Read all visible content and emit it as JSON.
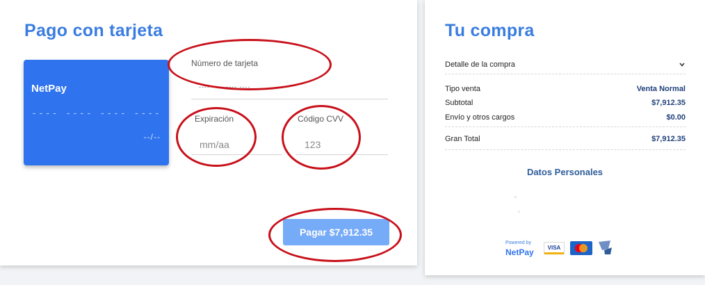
{
  "payment": {
    "title": "Pago con tarjeta",
    "card": {
      "brand": "NetPay",
      "number_mask": "---- ---- ---- ----",
      "expiry_mask": "--/--"
    },
    "fields": {
      "card_number_label": "Número de tarjeta",
      "card_number_placeholder": "---- ---- ---- ----",
      "expiry_label": "Expiración",
      "expiry_placeholder": "mm/aa",
      "cvv_label": "Código CVV",
      "cvv_placeholder": "123"
    },
    "pay_button_label": "Pagar $7,912.35"
  },
  "summary": {
    "title": "Tu compra",
    "detail_header": "Detalle de la compra",
    "rows": [
      {
        "label": "Tipo venta",
        "value": "Venta Normal"
      },
      {
        "label": "Subtotal",
        "value": "$7,912.35"
      },
      {
        "label": "Envío y otros cargos",
        "value": "$0.00"
      }
    ],
    "total": {
      "label": "Gran Total",
      "value": "$7,912.35"
    },
    "personal_data_title": "Datos Personales",
    "footer": {
      "powered_by": "Powered by",
      "netpay": "NetPay",
      "visa": "VISA"
    }
  },
  "icons": [
    "chevron-down-icon",
    "visa-logo",
    "mastercard-logo",
    "pci-logo"
  ],
  "colors": {
    "accent": "#3a7de0",
    "card": "#2f74ee",
    "pay_button": "#76abf7",
    "annotation_ring": "#c8101a",
    "value_text": "#1f3f7a"
  }
}
